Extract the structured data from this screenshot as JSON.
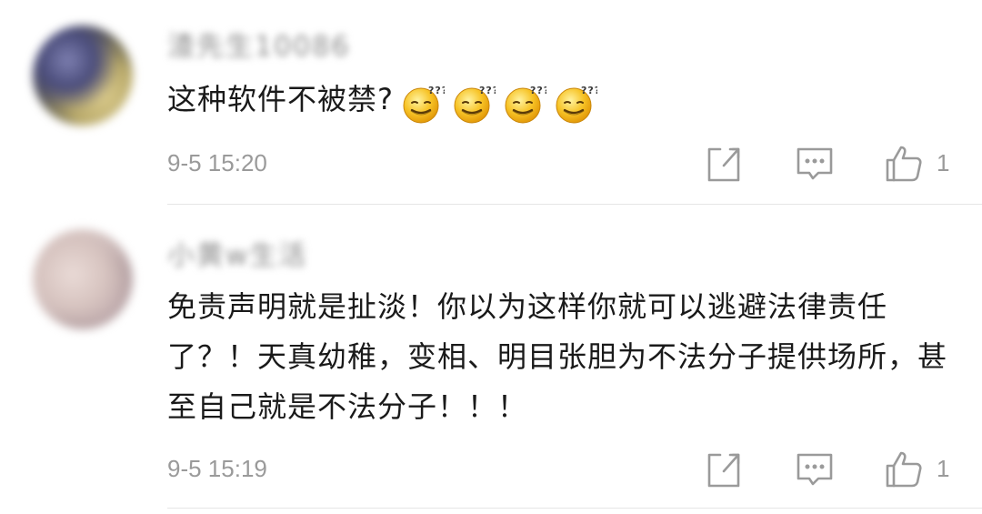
{
  "comments": [
    {
      "username": "渣先生10086",
      "text": "这种软件不被禁?",
      "emojis": [
        "confused-smile-icon",
        "confused-smile-icon",
        "confused-smile-icon",
        "confused-smile-icon"
      ],
      "timestamp": "9-5 15:20",
      "likes": "1"
    },
    {
      "username": "小黄w生活",
      "text": "免责声明就是扯淡！你以为这样你就可以逃避法律责任了？！天真幼稚，变相、明目张胆为不法分子提供场所，甚至自己就是不法分子！！！",
      "timestamp": "9-5 15:19",
      "likes": "1"
    }
  ],
  "colors": {
    "text": "#1a1a1a",
    "muted": "#9a9a9a",
    "divider": "#e6e6e6",
    "icon": "#9a9a9a"
  }
}
